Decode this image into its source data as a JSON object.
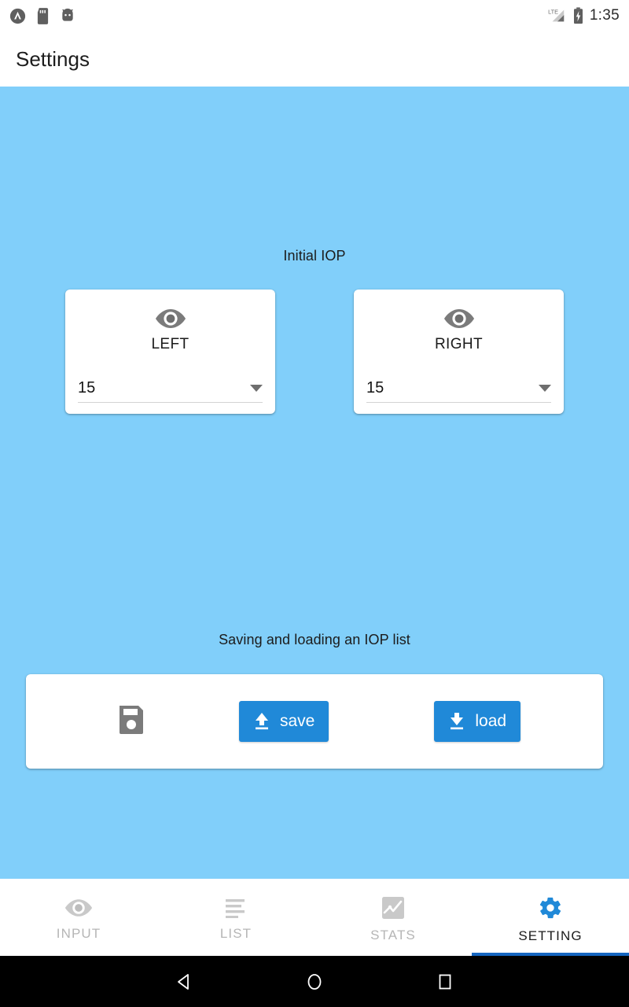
{
  "statusbar": {
    "left_icons": [
      "app-logo-icon",
      "sd-card-icon",
      "android-debug-icon"
    ],
    "signal_label": "LTE",
    "battery_icon": "battery-charging-icon",
    "time": "1:35"
  },
  "appbar": {
    "title": "Settings"
  },
  "main": {
    "iop_section_label": "Initial IOP",
    "eyes": [
      {
        "name": "LEFT",
        "icon": "eye-icon",
        "value": "15"
      },
      {
        "name": "RIGHT",
        "icon": "eye-icon",
        "value": "15"
      }
    ],
    "save_section_label": "Saving and loading an IOP list",
    "save_card": {
      "floppy_icon": "floppy-disk-icon",
      "save_button": {
        "label": "save",
        "icon": "upload-icon"
      },
      "load_button": {
        "label": "load",
        "icon": "download-icon"
      }
    }
  },
  "tabs": [
    {
      "label": "INPUT",
      "icon": "eye-icon",
      "active": false
    },
    {
      "label": "LIST",
      "icon": "list-lines-icon",
      "active": false
    },
    {
      "label": "STATS",
      "icon": "chart-icon",
      "active": false
    },
    {
      "label": "SETTING",
      "icon": "gear-icon",
      "active": true
    }
  ],
  "navbar": {
    "back": "back-triangle-icon",
    "home": "home-circle-icon",
    "recents": "recents-square-icon"
  },
  "colors": {
    "background": "#81cffa",
    "accent": "#2089d8",
    "active_tab": "#1565c0",
    "icon_gray": "#7b7b7b",
    "tab_inactive": "#b6b6b6"
  }
}
